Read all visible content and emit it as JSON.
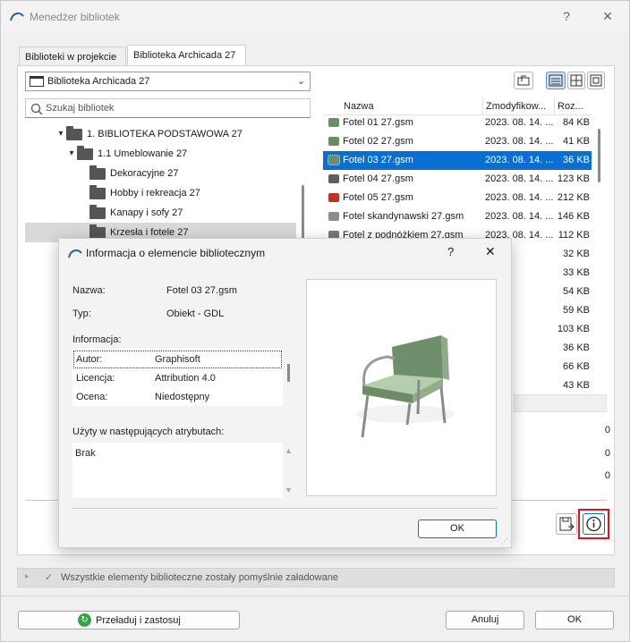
{
  "window": {
    "title": "Menedżer bibliotek",
    "help": "?",
    "close": "✕"
  },
  "tabs": [
    {
      "label": "Biblioteki w projekcie"
    },
    {
      "label": "Biblioteka Archicada 27"
    }
  ],
  "library_combo": {
    "value": "Biblioteka Archicada 27"
  },
  "search": {
    "placeholder": "Szukaj bibliotek"
  },
  "tree": {
    "root": "1. BIBLIOTEKA PODSTAWOWA 27",
    "sub": "1.1 Umeblowanie 27",
    "items": [
      "Dekoracyjne 27",
      "Hobby i rekreacja 27",
      "Kanapy i sofy 27",
      "Krzesła i fotele 27"
    ]
  },
  "file_list": {
    "headers": {
      "name": "Nazwa",
      "modified": "Zmodyfikow...",
      "size": "Roz..."
    },
    "rows": [
      {
        "name": "Fotel 01 27.gsm",
        "date": "2023. 08. 14. ...",
        "size": "84 KB",
        "color": "#6a8f62"
      },
      {
        "name": "Fotel 02 27.gsm",
        "date": "2023. 08. 14. ...",
        "size": "41 KB",
        "color": "#6b8c5e"
      },
      {
        "name": "Fotel 03 27.gsm",
        "date": "2023. 08. 14. ...",
        "size": "36 KB",
        "color": "#6e8e6a"
      },
      {
        "name": "Fotel 04 27.gsm",
        "date": "2023. 08. 14. ...",
        "size": "123 KB",
        "color": "#5f5f5f"
      },
      {
        "name": "Fotel 05 27.gsm",
        "date": "2023. 08. 14. ...",
        "size": "212 KB",
        "color": "#c0302a"
      },
      {
        "name": "Fotel skandynawski 27.gsm",
        "date": "2023. 08. 14. ...",
        "size": "146 KB",
        "color": "#8c8c8c"
      },
      {
        "name": "Fotel z podnóżkiem 27.gsm",
        "date": "2023. 08. 14. ...",
        "size": "112 KB",
        "color": "#7a7a7a"
      }
    ],
    "extra_sizes": [
      "32 KB",
      "33 KB",
      "54 KB",
      "59 KB",
      "103 KB",
      "36 KB",
      "66 KB",
      "43 KB"
    ]
  },
  "counts": [
    "0",
    "0",
    "0"
  ],
  "status": {
    "text": "Wszystkie elementy biblioteczne zostały pomyślnie załadowane"
  },
  "buttons": {
    "reload": "Przeładuj i zastosuj",
    "cancel": "Anuluj",
    "ok": "OK"
  },
  "dialog": {
    "title": "Informacja o elemencie bibliotecznym",
    "help": "?",
    "close": "✕",
    "name_label": "Nazwa:",
    "name_value": "Fotel 03 27.gsm",
    "type_label": "Typ:",
    "type_value": "Obiekt - GDL",
    "info_label": "Informacja:",
    "info_rows": [
      {
        "key": "Autor:",
        "value": "Graphisoft"
      },
      {
        "key": "Licencja:",
        "value": "Attribution 4.0"
      },
      {
        "key": "Ocena:",
        "value": "Niedostępny"
      }
    ],
    "used_label": "Użyty w następujących atrybutach:",
    "used_value": "Brak",
    "ok": "OK"
  }
}
